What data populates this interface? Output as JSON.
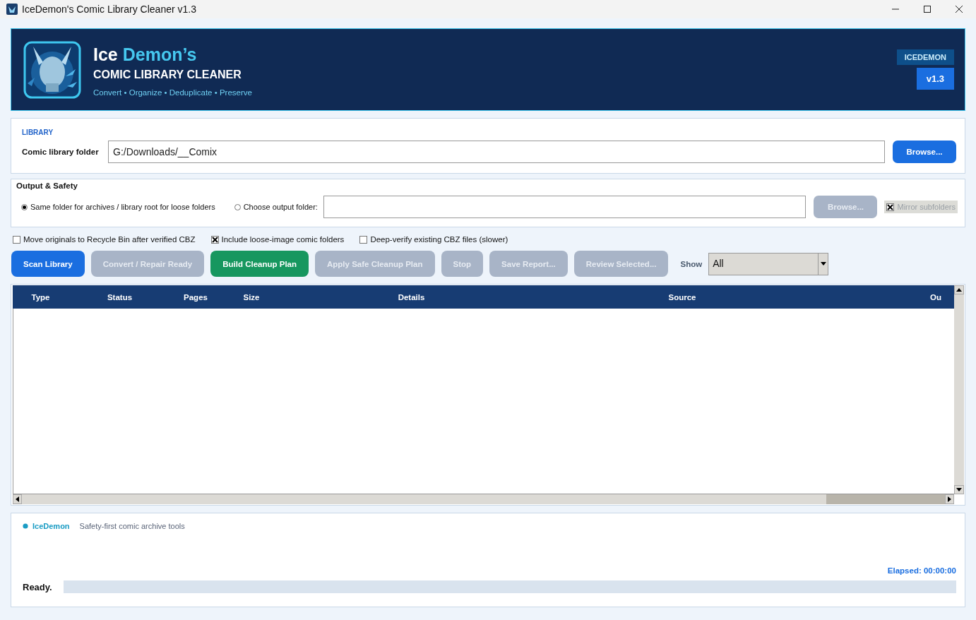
{
  "window": {
    "title": "IceDemon's Comic Library Cleaner v1.3"
  },
  "header": {
    "title_lead": "Ice",
    "title_accent": "Demon’s",
    "subtitle": "COMIC LIBRARY CLEANER",
    "tagline": "Convert • Organize • Deduplicate • Preserve",
    "brand_badge": "ICEDEMON",
    "version_badge": "v1.3"
  },
  "library": {
    "section_label": "LIBRARY",
    "field_label": "Comic library folder",
    "folder_value": "G:/Downloads/__Comix",
    "browse_button": "Browse..."
  },
  "output": {
    "title": "Output & Safety",
    "radios": [
      {
        "label": "Same folder for archives / library root for loose folders",
        "selected": true
      },
      {
        "label": "Choose output folder:",
        "selected": false
      }
    ],
    "browse_button": {
      "label": "Browse...",
      "disabled": true
    },
    "mirror": {
      "label": "Mirror subfolders",
      "checked": true,
      "disabled": true
    }
  },
  "options": [
    {
      "label": "Move originals to Recycle Bin after verified CBZ",
      "checked": false
    },
    {
      "label": "Include loose-image comic folders",
      "checked": true
    },
    {
      "label": "Deep-verify existing CBZ files (slower)",
      "checked": false
    }
  ],
  "actions": [
    {
      "label": "Scan Library",
      "kind": "primary",
      "disabled": false
    },
    {
      "label": "Convert / Repair Ready",
      "kind": "plain",
      "disabled": true
    },
    {
      "label": "Build Cleanup Plan",
      "kind": "success",
      "disabled": false
    },
    {
      "label": "Apply Safe Cleanup Plan",
      "kind": "plain",
      "disabled": true
    },
    {
      "label": "Stop",
      "kind": "plain",
      "disabled": true
    },
    {
      "label": "Save Report...",
      "kind": "plain",
      "disabled": true
    },
    {
      "label": "Review Selected...",
      "kind": "plain",
      "disabled": true
    }
  ],
  "filter": {
    "label": "Show",
    "value": "All"
  },
  "table": {
    "columns": [
      "Type",
      "Status",
      "Pages",
      "Size",
      "Details",
      "Source",
      "Ou"
    ]
  },
  "footer": {
    "brand": "IceDemon",
    "tagline": "Safety-first comic archive tools",
    "elapsed": "Elapsed: 00:00:00",
    "status": "Ready.",
    "level": 0
  }
}
